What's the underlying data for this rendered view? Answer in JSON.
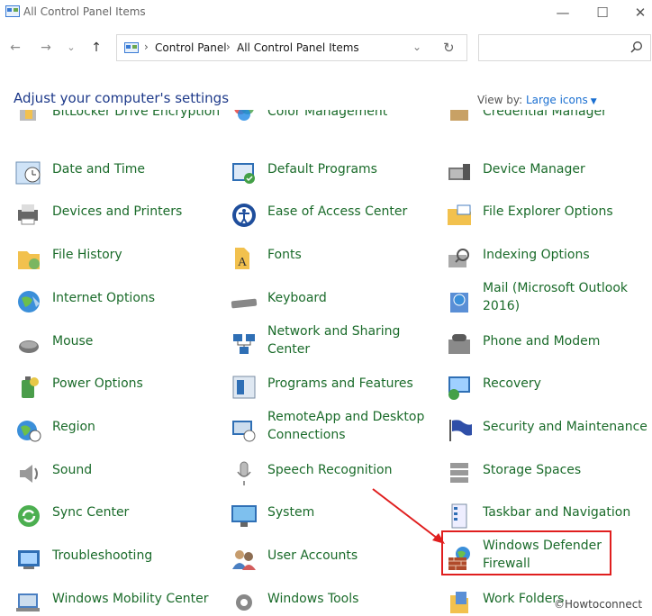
{
  "window": {
    "title": "All Control Panel Items",
    "minimize": "—",
    "maximize": "☐",
    "close": "✕"
  },
  "nav": {
    "back": "←",
    "forward": "→",
    "recent": "⌄",
    "up": "↑"
  },
  "address": {
    "crumbs": [
      "Control Panel",
      "All Control Panel Items"
    ],
    "separator": "›",
    "dropdown": "⌄",
    "refresh": "↻"
  },
  "search": {
    "placeholder": "",
    "value": ""
  },
  "header": {
    "title": "Adjust your computer's settings",
    "view_by_label": "View by:",
    "view_by_value": "Large icons"
  },
  "items": {
    "col1": [
      {
        "label": "BitLocker Drive Encryption",
        "icon": "bitlocker-icon"
      },
      {
        "label": "Date and Time",
        "icon": "clock-icon"
      },
      {
        "label": "Devices and Printers",
        "icon": "printer-icon"
      },
      {
        "label": "File History",
        "icon": "file-history-icon"
      },
      {
        "label": "Internet Options",
        "icon": "globe-icon"
      },
      {
        "label": "Mouse",
        "icon": "mouse-icon"
      },
      {
        "label": "Power Options",
        "icon": "battery-icon"
      },
      {
        "label": "Region",
        "icon": "globe-clock-icon"
      },
      {
        "label": "Sound",
        "icon": "speaker-icon"
      },
      {
        "label": "Sync Center",
        "icon": "sync-icon"
      },
      {
        "label": "Troubleshooting",
        "icon": "troubleshoot-icon"
      },
      {
        "label": "Windows Mobility Center",
        "icon": "mobility-icon"
      }
    ],
    "col2": [
      {
        "label": "Color Management",
        "icon": "color-icon"
      },
      {
        "label": "Default Programs",
        "icon": "default-programs-icon"
      },
      {
        "label": "Ease of Access Center",
        "icon": "accessibility-icon"
      },
      {
        "label": "Fonts",
        "icon": "fonts-icon"
      },
      {
        "label": "Keyboard",
        "icon": "keyboard-icon"
      },
      {
        "label": "Network and Sharing Center",
        "line1": "Network and Sharing",
        "line2": "Center",
        "icon": "network-icon"
      },
      {
        "label": "Programs and Features",
        "icon": "programs-icon"
      },
      {
        "label": "RemoteApp and Desktop Connections",
        "line1": "RemoteApp and Desktop",
        "line2": "Connections",
        "icon": "remote-desktop-icon"
      },
      {
        "label": "Speech Recognition",
        "icon": "microphone-icon"
      },
      {
        "label": "System",
        "icon": "monitor-icon"
      },
      {
        "label": "User Accounts",
        "icon": "users-icon"
      },
      {
        "label": "Windows Tools",
        "icon": "gear-icon"
      }
    ],
    "col3": [
      {
        "label": "Credential Manager",
        "icon": "credential-icon"
      },
      {
        "label": "Device Manager",
        "icon": "device-manager-icon"
      },
      {
        "label": "File Explorer Options",
        "icon": "folder-icon"
      },
      {
        "label": "Indexing Options",
        "icon": "indexing-icon"
      },
      {
        "label": "Mail (Microsoft Outlook 2016)",
        "line1": "Mail (Microsoft Outlook",
        "line2": "2016)",
        "icon": "mail-icon"
      },
      {
        "label": "Phone and Modem",
        "icon": "phone-icon"
      },
      {
        "label": "Recovery",
        "icon": "recovery-icon"
      },
      {
        "label": "Security and Maintenance",
        "icon": "flag-icon"
      },
      {
        "label": "Storage Spaces",
        "icon": "storage-icon"
      },
      {
        "label": "Taskbar and Navigation",
        "icon": "taskbar-icon"
      },
      {
        "label": "Windows Defender Firewall",
        "line1": "Windows Defender",
        "line2": "Firewall",
        "icon": "firewall-icon"
      },
      {
        "label": "Work Folders",
        "icon": "work-folders-icon"
      }
    ]
  },
  "watermark": "©Howtoconnect",
  "colors": {
    "link": "#1a6b2a",
    "accent": "#1a6fd1",
    "highlight": "#e01e1e",
    "heading": "#1e3a8a"
  }
}
